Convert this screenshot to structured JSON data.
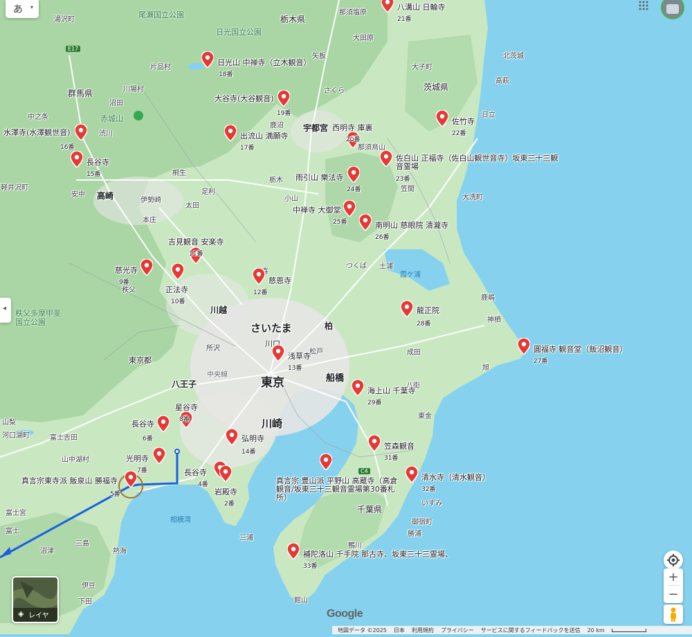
{
  "map": {
    "ime_label": "あ",
    "layers_label": "レイヤ",
    "google_logo": "Google",
    "colors": {
      "sea": "#86d2ee",
      "land": "#c9e8c2",
      "forest": "#a4d2a0",
      "urban": "#e6e6e4",
      "pin": "#e53935",
      "route": "#1a5fe0"
    },
    "icons": [
      "layers-icon",
      "locate-icon",
      "zoom-in-icon",
      "zoom-out-icon",
      "pegman-icon",
      "apps-grid-icon",
      "avatar"
    ]
  },
  "footer": {
    "map_data": "地図データ ©2025",
    "country": "日本",
    "terms": "利用規約",
    "privacy": "プライバシー",
    "feedback": "サービスに関するフィードバックを送信",
    "scale": "20 km"
  },
  "pins": [
    {
      "title": "八溝山 日輪寺",
      "num": "21番"
    },
    {
      "title": "日光山 中禅寺（立木観音）",
      "num": "18番"
    },
    {
      "title": "大谷寺(大谷観音)",
      "num": "19番"
    },
    {
      "title": "佐竹寺",
      "num": "22番"
    },
    {
      "title": "西明寺 庫裏",
      "num": "20番"
    },
    {
      "title": "出流山 満願寺",
      "num": "17番"
    },
    {
      "title": "水澤寺(水澤観世音)",
      "num": "16番"
    },
    {
      "title": "長谷寺",
      "num": "15番"
    },
    {
      "title": "佐白山 正福寺（佐白山観世音寺）坂東三十三観音霊場",
      "num": "23番"
    },
    {
      "title": "雨引山 樂法寺",
      "num": "24番"
    },
    {
      "title": "中禅寺 大御堂",
      "num": "25番"
    },
    {
      "title": "南明山 慈眼院 清瀧寺",
      "num": "26番"
    },
    {
      "title": "吉見観音 安楽寺",
      "num": "11番"
    },
    {
      "title": "慈光寺",
      "num": "9番"
    },
    {
      "title": "正法寺",
      "num": "10番"
    },
    {
      "title": "慈恩寺",
      "num": "12番"
    },
    {
      "title": "龍正院",
      "num": "28番"
    },
    {
      "title": "圓福寺 観音堂（飯沼観音）",
      "num": "27番"
    },
    {
      "title": "浅草寺",
      "num": "13番"
    },
    {
      "title": "海上山 千葉寺",
      "num": "29番"
    },
    {
      "title": "星谷寺",
      "num": "8番"
    },
    {
      "title": "長谷寺",
      "num": "6番"
    },
    {
      "title": "弘明寺",
      "num": "14番"
    },
    {
      "title": "笠森観音",
      "num": "31番"
    },
    {
      "title": "光明寺",
      "num": "7番"
    },
    {
      "title": "長谷寺",
      "num": "4番"
    },
    {
      "title": "真言宗東寺派 飯泉山 勝福寺",
      "num": "5番"
    },
    {
      "title": "岩殿寺",
      "num": "2番"
    },
    {
      "title": "真言宗 豊山派 平野山 高蔵寺（高倉観音/坂東三十三観音霊場第30番札所）",
      "num": ""
    },
    {
      "title": "清水寺（清水観音）",
      "num": "32番"
    },
    {
      "title": "補陀洛山 千手院 那古寺、坂東三十三霊場、",
      "num": "33番"
    }
  ],
  "places": {
    "tokyo": "東京",
    "saitama": "さいたま",
    "kawasaki": "川崎",
    "utsunomiya": "宇都宮",
    "kawagoe": "川越",
    "takasaki": "高崎",
    "funabashi": "船橋",
    "kawaguchi": "川口",
    "kashiwa": "柏",
    "hachioji": "八王子",
    "nasushiobara": "那須塩原",
    "tochigi_pref": "栃木県",
    "ibaraki_pref": "茨城県",
    "gunma_pref": "群馬県",
    "tokyo_pref": "東京都",
    "chiba_pref": "千葉県",
    "oze": "尾瀬国立公園",
    "nikko_np": "日光国立公園",
    "chichibu_np": "秩父多摩甲斐\n国立公園",
    "akagi": "赤城山",
    "sagami_bay": "相模湾",
    "kasumigaura": "霞ケ浦",
    "yuzawa": "湯沢町",
    "kitasuzawa": "北茨城",
    "daigo": "大子町",
    "takahagi": "高萩",
    "hitachi": "日立",
    "oarai": "大洗町",
    "kashima": "鹿嶋",
    "kamisu": "神栖",
    "narita": "成田",
    "asahi": "旭",
    "yachimata": "八街",
    "togane": "東金",
    "isumi": "いすみ",
    "onjuku": "御宿町",
    "katsuura": "勝浦",
    "kamogawa": "鴨川",
    "tateyama": "館山",
    "miura": "三浦",
    "atami": "熱海",
    "ito": "伊豆",
    "numazu": "沼津",
    "mishima": "三島",
    "fujinomiya": "富士宮",
    "fuji": "富士",
    "shimoda": "下田",
    "yamanashi": "山梨",
    "fujiyoshida": "富士吉田",
    "kawaguchiko": "河口湖町",
    "yamanakako": "山中湖村",
    "tsuchiura": "土浦",
    "tsukuba": "つくば",
    "kuki": "久喜",
    "ota": "太田",
    "ashikaga": "足利",
    "kiryu": "桐生",
    "isesaki": "伊勢崎",
    "honjo": "本庄",
    "chichibu": "秩父",
    "tokorozawa": "所沢",
    "matsudo": "松戸",
    "oyama": "小山",
    "tochigi": "栃木",
    "kanuma": "鹿沼",
    "sakura": "さくら",
    "yaita": "矢板",
    "otawara": "大田原",
    "numata": "沼田",
    "kawaba": "川場村",
    "katashina": "片品村",
    "nakanojo": "中之条",
    "shibukawa": "渋川",
    "karuizawa": "軽井沢町",
    "annaka": "安中",
    "kasama": "笠間",
    "nasu": "那須烏山",
    "chuo_line": "中央線",
    "c4": "C4",
    "e17": "E17"
  }
}
